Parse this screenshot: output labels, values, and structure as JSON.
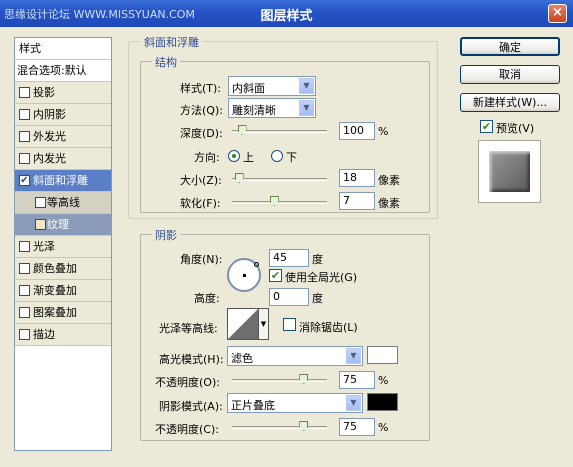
{
  "window": {
    "title": "图层样式",
    "watermark": "思缘设计论坛 WWW.MISSYUAN.COM",
    "close_glyph": "×"
  },
  "styles_panel": {
    "header": "样式",
    "blend_options": "混合选项:默认",
    "items": [
      {
        "label": "投影",
        "checked": false
      },
      {
        "label": "内阴影",
        "checked": false
      },
      {
        "label": "外发光",
        "checked": false
      },
      {
        "label": "内发光",
        "checked": false
      },
      {
        "label": "斜面和浮雕",
        "checked": true
      },
      {
        "label": "等高线",
        "checked": false
      },
      {
        "label": "纹理",
        "checked": false
      },
      {
        "label": "光泽",
        "checked": false
      },
      {
        "label": "颜色叠加",
        "checked": false
      },
      {
        "label": "渐变叠加",
        "checked": false
      },
      {
        "label": "图案叠加",
        "checked": false
      },
      {
        "label": "描边",
        "checked": false
      }
    ],
    "check_glyph": "✔"
  },
  "bevel": {
    "group_title": "斜面和浮雕",
    "structure": {
      "title": "结构",
      "style_label": "样式(T):",
      "style_value": "内斜面",
      "technique_label": "方法(Q):",
      "technique_value": "雕刻清晰",
      "depth_label": "深度(D):",
      "depth_value": "100",
      "depth_unit": "%",
      "depth_level": 0.1,
      "direction_label": "方向:",
      "direction_up": "上",
      "direction_down": "下",
      "size_label": "大小(Z):",
      "size_value": "18",
      "size_unit": "像素",
      "size_level": 0.07,
      "soften_label": "软化(F):",
      "soften_value": "7",
      "soften_unit": "像素",
      "soften_level": 0.44
    },
    "shading": {
      "title": "阴影",
      "angle_label": "角度(N):",
      "angle_value": "45",
      "angle_unit": "度",
      "global_light_label": "使用全局光(G)",
      "global_light_checked": true,
      "altitude_label": "高度:",
      "altitude_value": "0",
      "altitude_unit": "度",
      "gloss_contour_label": "光泽等高线:",
      "anti_alias_label": "消除锯齿(L)",
      "anti_alias_checked": false,
      "highlight_mode_label": "高光模式(H):",
      "highlight_mode_value": "滤色",
      "highlight_color": "#ffffff",
      "highlight_opacity_label": "不透明度(O):",
      "highlight_opacity_value": "75",
      "highlight_opacity_unit": "%",
      "highlight_opacity_level": 0.75,
      "shadow_mode_label": "阴影模式(A):",
      "shadow_mode_value": "正片叠底",
      "shadow_color": "#000000",
      "shadow_opacity_label": "不透明度(C):",
      "shadow_opacity_value": "75",
      "shadow_opacity_unit": "%",
      "shadow_opacity_level": 0.75
    }
  },
  "buttons": {
    "ok": "确定",
    "cancel": "取消",
    "new_style": "新建样式(W)...",
    "preview_label": "预览(V)",
    "preview_checked": true
  },
  "dropdown_glyph": "▼",
  "colors": {
    "accent": "#5b7fc6",
    "titlebar": "#2552c4"
  }
}
